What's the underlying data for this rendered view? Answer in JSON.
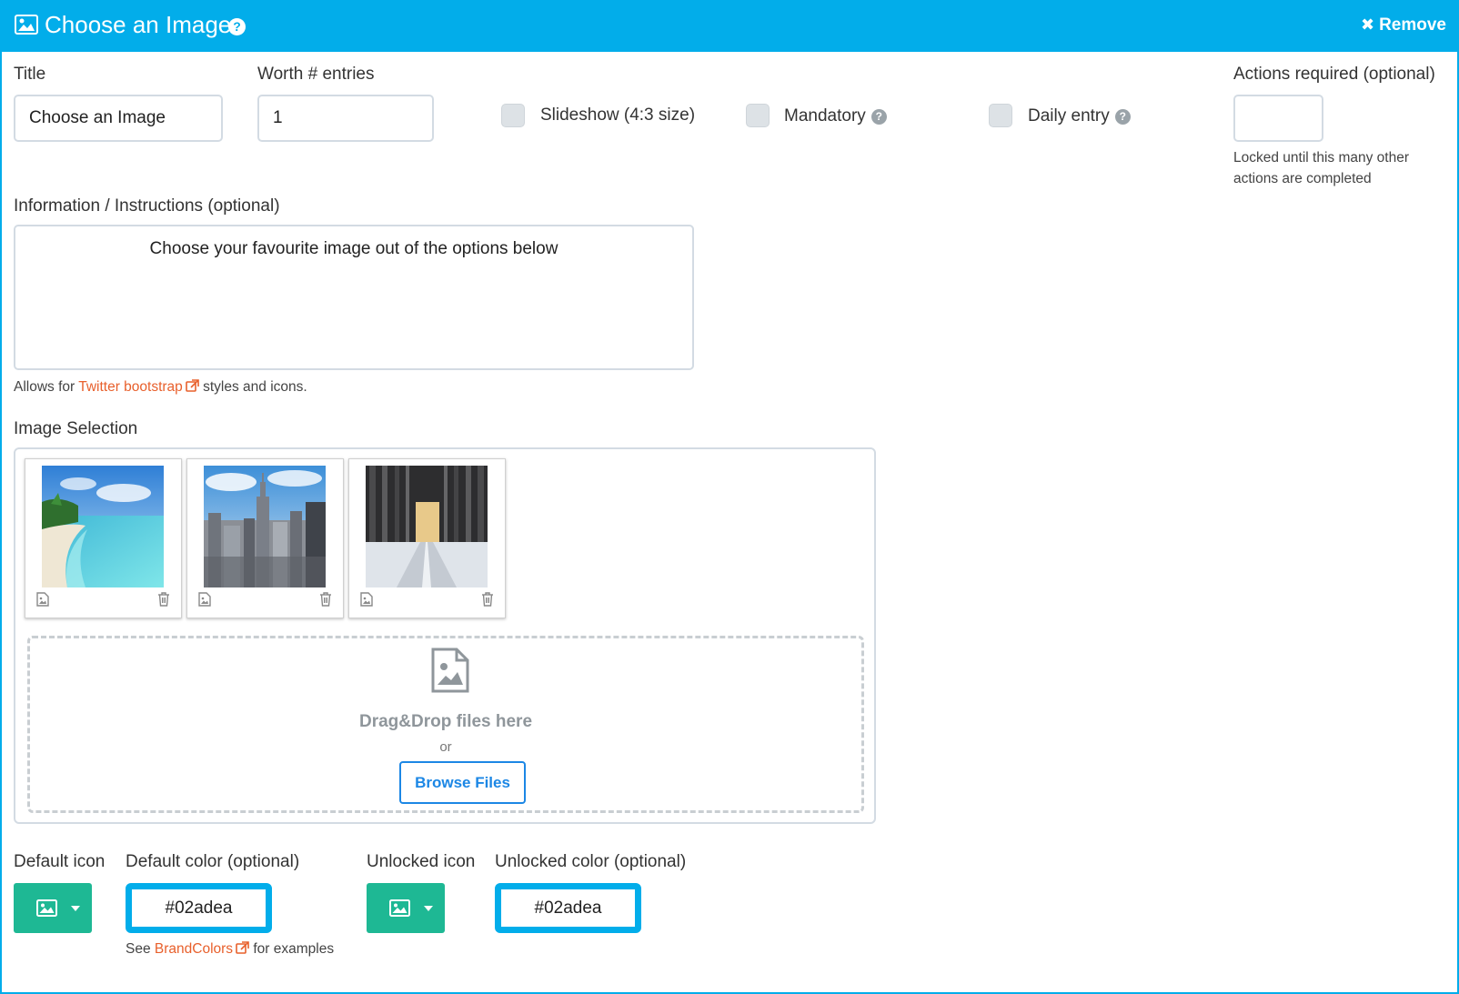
{
  "header": {
    "title": "Choose an Image",
    "remove_label": "Remove",
    "color": "#02adea"
  },
  "fields": {
    "title_label": "Title",
    "title_value": "Choose an Image",
    "worth_label": "Worth # entries",
    "worth_value": "1",
    "slideshow_label": "Slideshow (4:3 size)",
    "mandatory_label": "Mandatory",
    "daily_label": "Daily entry",
    "actions_label": "Actions required (optional)",
    "actions_value": "",
    "actions_help_1": "Locked until this many other",
    "actions_help_2": "actions are completed",
    "info_label": "Information / Instructions (optional)",
    "info_value": "Choose your favourite image out of the options below",
    "info_help_prefix": "Allows for",
    "info_help_link": "Twitter bootstrap",
    "info_help_suffix": "styles and icons."
  },
  "image_selection": {
    "label": "Image Selection",
    "images": [
      {
        "name": "beach-image"
      },
      {
        "name": "city-image"
      },
      {
        "name": "snowy-forest-image"
      }
    ],
    "dropzone_text": "Drag&Drop files here",
    "dropzone_or": "or",
    "browse_label": "Browse Files"
  },
  "icons": {
    "default_icon_label": "Default icon",
    "default_color_label": "Default color (optional)",
    "default_color_value": "#02adea",
    "unlocked_icon_label": "Unlocked icon",
    "unlocked_color_label": "Unlocked color (optional)",
    "unlocked_color_value": "#02adea",
    "see_prefix": "See",
    "see_link": "BrandColors",
    "see_suffix": "for examples",
    "button_color": "#1eb894"
  }
}
